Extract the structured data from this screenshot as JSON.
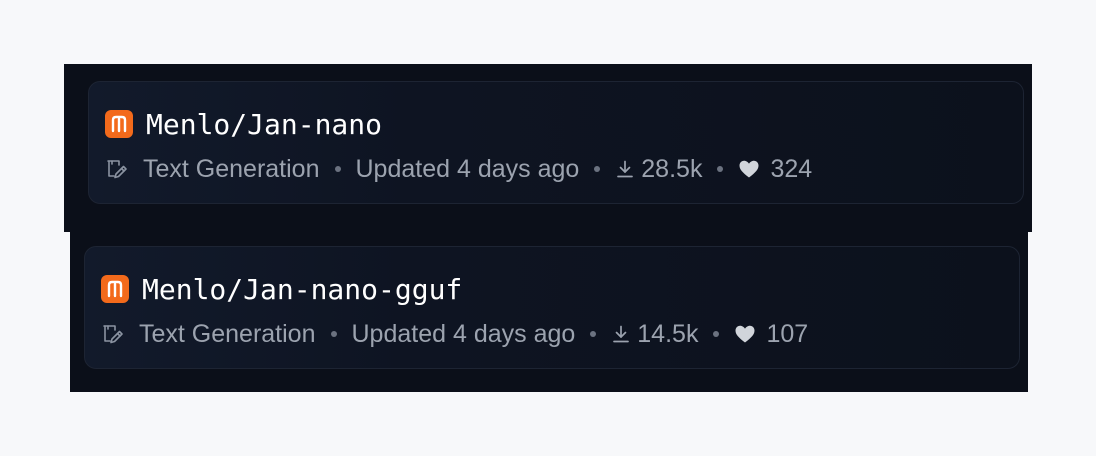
{
  "colors": {
    "page_background": "#f7f8fa",
    "panel_background": "#0b0f19",
    "card_border": "#1d2433",
    "logo_orange": "#f36a1b",
    "title_text": "#ffffff",
    "meta_text": "#9ca3af"
  },
  "icons": {
    "logo": "menlo-logo-icon",
    "task": "text-generation-icon",
    "downloads": "download-icon",
    "likes": "heart-icon"
  },
  "models": [
    {
      "title": "Menlo/Jan-nano",
      "task": "Text Generation",
      "updated": "Updated 4 days ago",
      "downloads": "28.5k",
      "likes": "324"
    },
    {
      "title": "Menlo/Jan-nano-gguf",
      "task": "Text Generation",
      "updated": "Updated 4 days ago",
      "downloads": "14.5k",
      "likes": "107"
    }
  ]
}
